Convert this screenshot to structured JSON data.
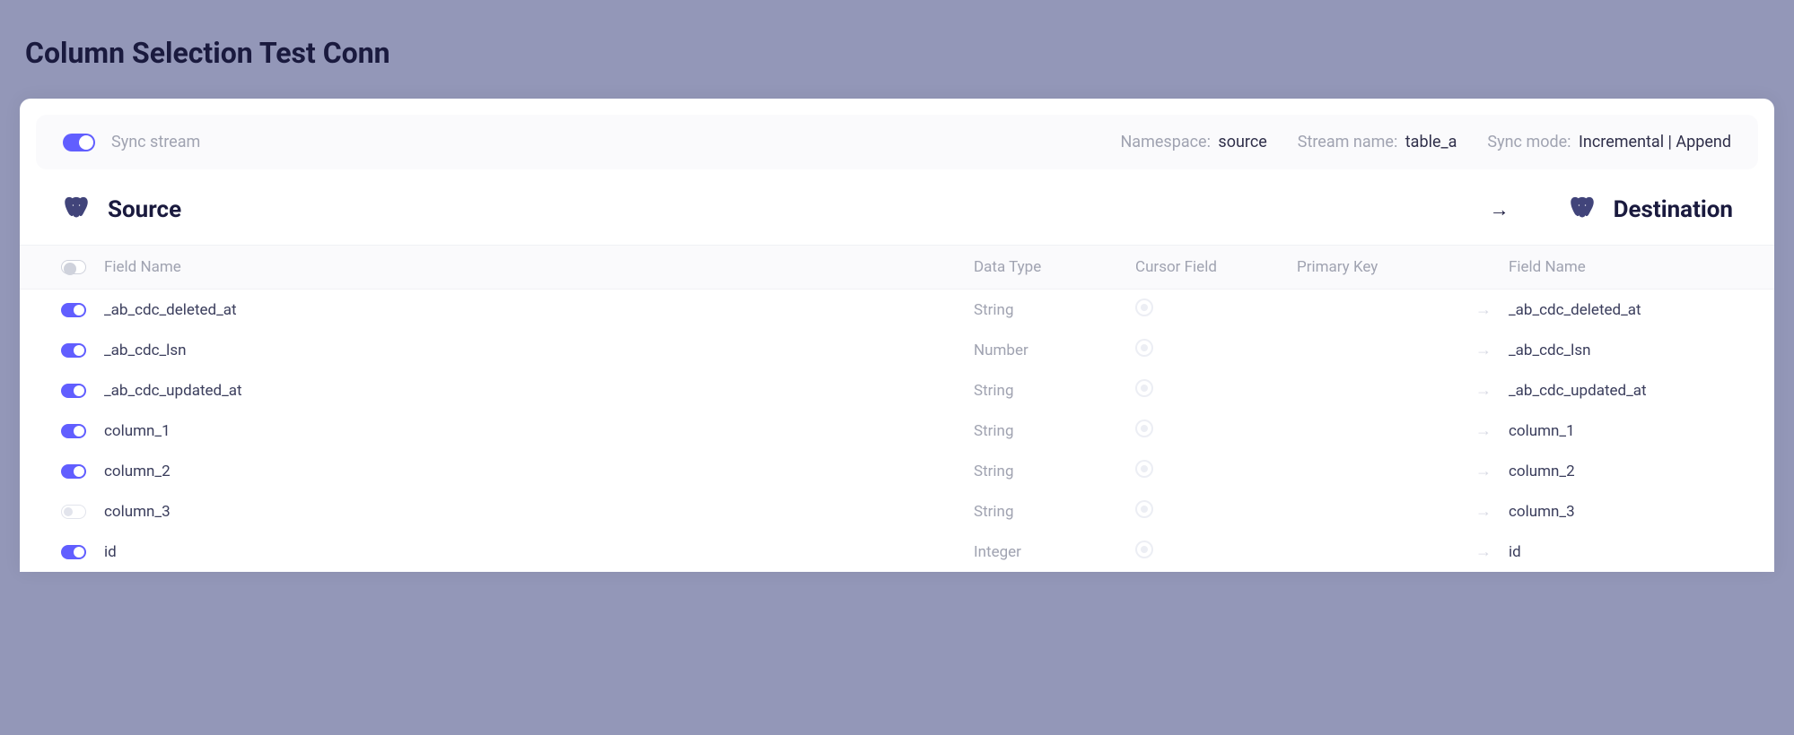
{
  "page": {
    "title": "Column Selection Test Conn"
  },
  "stream": {
    "sync_label": "Sync stream",
    "sync_enabled": true,
    "namespace_label": "Namespace:",
    "namespace_value": "source",
    "name_label": "Stream name:",
    "name_value": "table_a",
    "mode_label": "Sync mode:",
    "mode_value": "Incremental | Append"
  },
  "sections": {
    "source": "Source",
    "destination": "Destination"
  },
  "columns": {
    "field_name": "Field Name",
    "data_type": "Data Type",
    "cursor": "Cursor Field",
    "pk": "Primary Key",
    "dest_field_name": "Field Name"
  },
  "rows": [
    {
      "enabled": true,
      "field": "_ab_cdc_deleted_at",
      "type": "String",
      "dest": "_ab_cdc_deleted_at"
    },
    {
      "enabled": true,
      "field": "_ab_cdc_lsn",
      "type": "Number",
      "dest": "_ab_cdc_lsn"
    },
    {
      "enabled": true,
      "field": "_ab_cdc_updated_at",
      "type": "String",
      "dest": "_ab_cdc_updated_at"
    },
    {
      "enabled": true,
      "field": "column_1",
      "type": "String",
      "dest": "column_1"
    },
    {
      "enabled": true,
      "field": "column_2",
      "type": "String",
      "dest": "column_2"
    },
    {
      "enabled": false,
      "field": "column_3",
      "type": "String",
      "dest": "column_3"
    },
    {
      "enabled": true,
      "field": "id",
      "type": "Integer",
      "dest": "id"
    }
  ]
}
